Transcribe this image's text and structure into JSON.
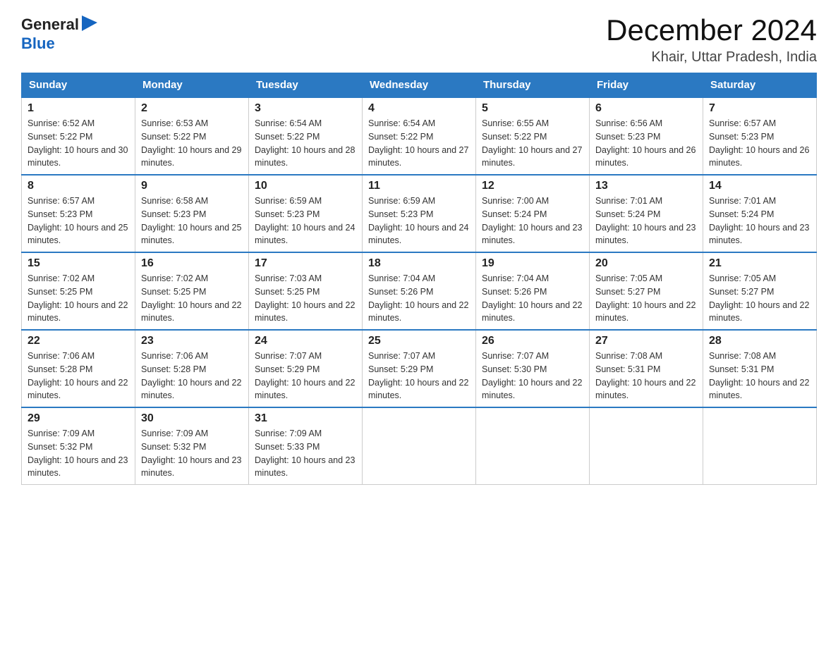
{
  "logo": {
    "text_general": "General",
    "triangle": "▶",
    "text_blue": "Blue"
  },
  "header": {
    "title": "December 2024",
    "subtitle": "Khair, Uttar Pradesh, India"
  },
  "weekdays": [
    "Sunday",
    "Monday",
    "Tuesday",
    "Wednesday",
    "Thursday",
    "Friday",
    "Saturday"
  ],
  "weeks": [
    [
      {
        "day": "1",
        "sunrise": "6:52 AM",
        "sunset": "5:22 PM",
        "daylight": "10 hours and 30 minutes."
      },
      {
        "day": "2",
        "sunrise": "6:53 AM",
        "sunset": "5:22 PM",
        "daylight": "10 hours and 29 minutes."
      },
      {
        "day": "3",
        "sunrise": "6:54 AM",
        "sunset": "5:22 PM",
        "daylight": "10 hours and 28 minutes."
      },
      {
        "day": "4",
        "sunrise": "6:54 AM",
        "sunset": "5:22 PM",
        "daylight": "10 hours and 27 minutes."
      },
      {
        "day": "5",
        "sunrise": "6:55 AM",
        "sunset": "5:22 PM",
        "daylight": "10 hours and 27 minutes."
      },
      {
        "day": "6",
        "sunrise": "6:56 AM",
        "sunset": "5:23 PM",
        "daylight": "10 hours and 26 minutes."
      },
      {
        "day": "7",
        "sunrise": "6:57 AM",
        "sunset": "5:23 PM",
        "daylight": "10 hours and 26 minutes."
      }
    ],
    [
      {
        "day": "8",
        "sunrise": "6:57 AM",
        "sunset": "5:23 PM",
        "daylight": "10 hours and 25 minutes."
      },
      {
        "day": "9",
        "sunrise": "6:58 AM",
        "sunset": "5:23 PM",
        "daylight": "10 hours and 25 minutes."
      },
      {
        "day": "10",
        "sunrise": "6:59 AM",
        "sunset": "5:23 PM",
        "daylight": "10 hours and 24 minutes."
      },
      {
        "day": "11",
        "sunrise": "6:59 AM",
        "sunset": "5:23 PM",
        "daylight": "10 hours and 24 minutes."
      },
      {
        "day": "12",
        "sunrise": "7:00 AM",
        "sunset": "5:24 PM",
        "daylight": "10 hours and 23 minutes."
      },
      {
        "day": "13",
        "sunrise": "7:01 AM",
        "sunset": "5:24 PM",
        "daylight": "10 hours and 23 minutes."
      },
      {
        "day": "14",
        "sunrise": "7:01 AM",
        "sunset": "5:24 PM",
        "daylight": "10 hours and 23 minutes."
      }
    ],
    [
      {
        "day": "15",
        "sunrise": "7:02 AM",
        "sunset": "5:25 PM",
        "daylight": "10 hours and 22 minutes."
      },
      {
        "day": "16",
        "sunrise": "7:02 AM",
        "sunset": "5:25 PM",
        "daylight": "10 hours and 22 minutes."
      },
      {
        "day": "17",
        "sunrise": "7:03 AM",
        "sunset": "5:25 PM",
        "daylight": "10 hours and 22 minutes."
      },
      {
        "day": "18",
        "sunrise": "7:04 AM",
        "sunset": "5:26 PM",
        "daylight": "10 hours and 22 minutes."
      },
      {
        "day": "19",
        "sunrise": "7:04 AM",
        "sunset": "5:26 PM",
        "daylight": "10 hours and 22 minutes."
      },
      {
        "day": "20",
        "sunrise": "7:05 AM",
        "sunset": "5:27 PM",
        "daylight": "10 hours and 22 minutes."
      },
      {
        "day": "21",
        "sunrise": "7:05 AM",
        "sunset": "5:27 PM",
        "daylight": "10 hours and 22 minutes."
      }
    ],
    [
      {
        "day": "22",
        "sunrise": "7:06 AM",
        "sunset": "5:28 PM",
        "daylight": "10 hours and 22 minutes."
      },
      {
        "day": "23",
        "sunrise": "7:06 AM",
        "sunset": "5:28 PM",
        "daylight": "10 hours and 22 minutes."
      },
      {
        "day": "24",
        "sunrise": "7:07 AM",
        "sunset": "5:29 PM",
        "daylight": "10 hours and 22 minutes."
      },
      {
        "day": "25",
        "sunrise": "7:07 AM",
        "sunset": "5:29 PM",
        "daylight": "10 hours and 22 minutes."
      },
      {
        "day": "26",
        "sunrise": "7:07 AM",
        "sunset": "5:30 PM",
        "daylight": "10 hours and 22 minutes."
      },
      {
        "day": "27",
        "sunrise": "7:08 AM",
        "sunset": "5:31 PM",
        "daylight": "10 hours and 22 minutes."
      },
      {
        "day": "28",
        "sunrise": "7:08 AM",
        "sunset": "5:31 PM",
        "daylight": "10 hours and 22 minutes."
      }
    ],
    [
      {
        "day": "29",
        "sunrise": "7:09 AM",
        "sunset": "5:32 PM",
        "daylight": "10 hours and 23 minutes."
      },
      {
        "day": "30",
        "sunrise": "7:09 AM",
        "sunset": "5:32 PM",
        "daylight": "10 hours and 23 minutes."
      },
      {
        "day": "31",
        "sunrise": "7:09 AM",
        "sunset": "5:33 PM",
        "daylight": "10 hours and 23 minutes."
      },
      null,
      null,
      null,
      null
    ]
  ]
}
